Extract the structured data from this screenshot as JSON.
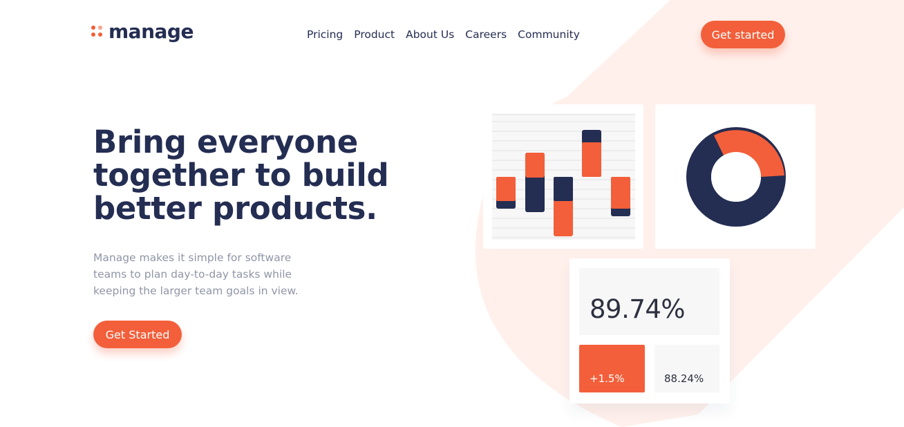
{
  "brand": {
    "name": "manage"
  },
  "nav": {
    "links": [
      "Pricing",
      "Product",
      "About Us",
      "Careers",
      "Community"
    ],
    "cta_label": "Get started"
  },
  "hero": {
    "title": "Bring everyone together to build better products.",
    "description": "Manage makes it simple for software teams to plan day-to-day tasks while keeping the larger team goals in view.",
    "cta_label": "Get Started"
  },
  "illustration": {
    "stats": {
      "main_value": "89.74%",
      "change_value": "+1.5%",
      "side_value": "88.24%"
    }
  },
  "colors": {
    "accent": "#f25f3a",
    "navy": "#242d52",
    "muted_text": "#9095a7",
    "background_tint": "#fff0ec",
    "panel_gray": "#f7f7f7"
  }
}
